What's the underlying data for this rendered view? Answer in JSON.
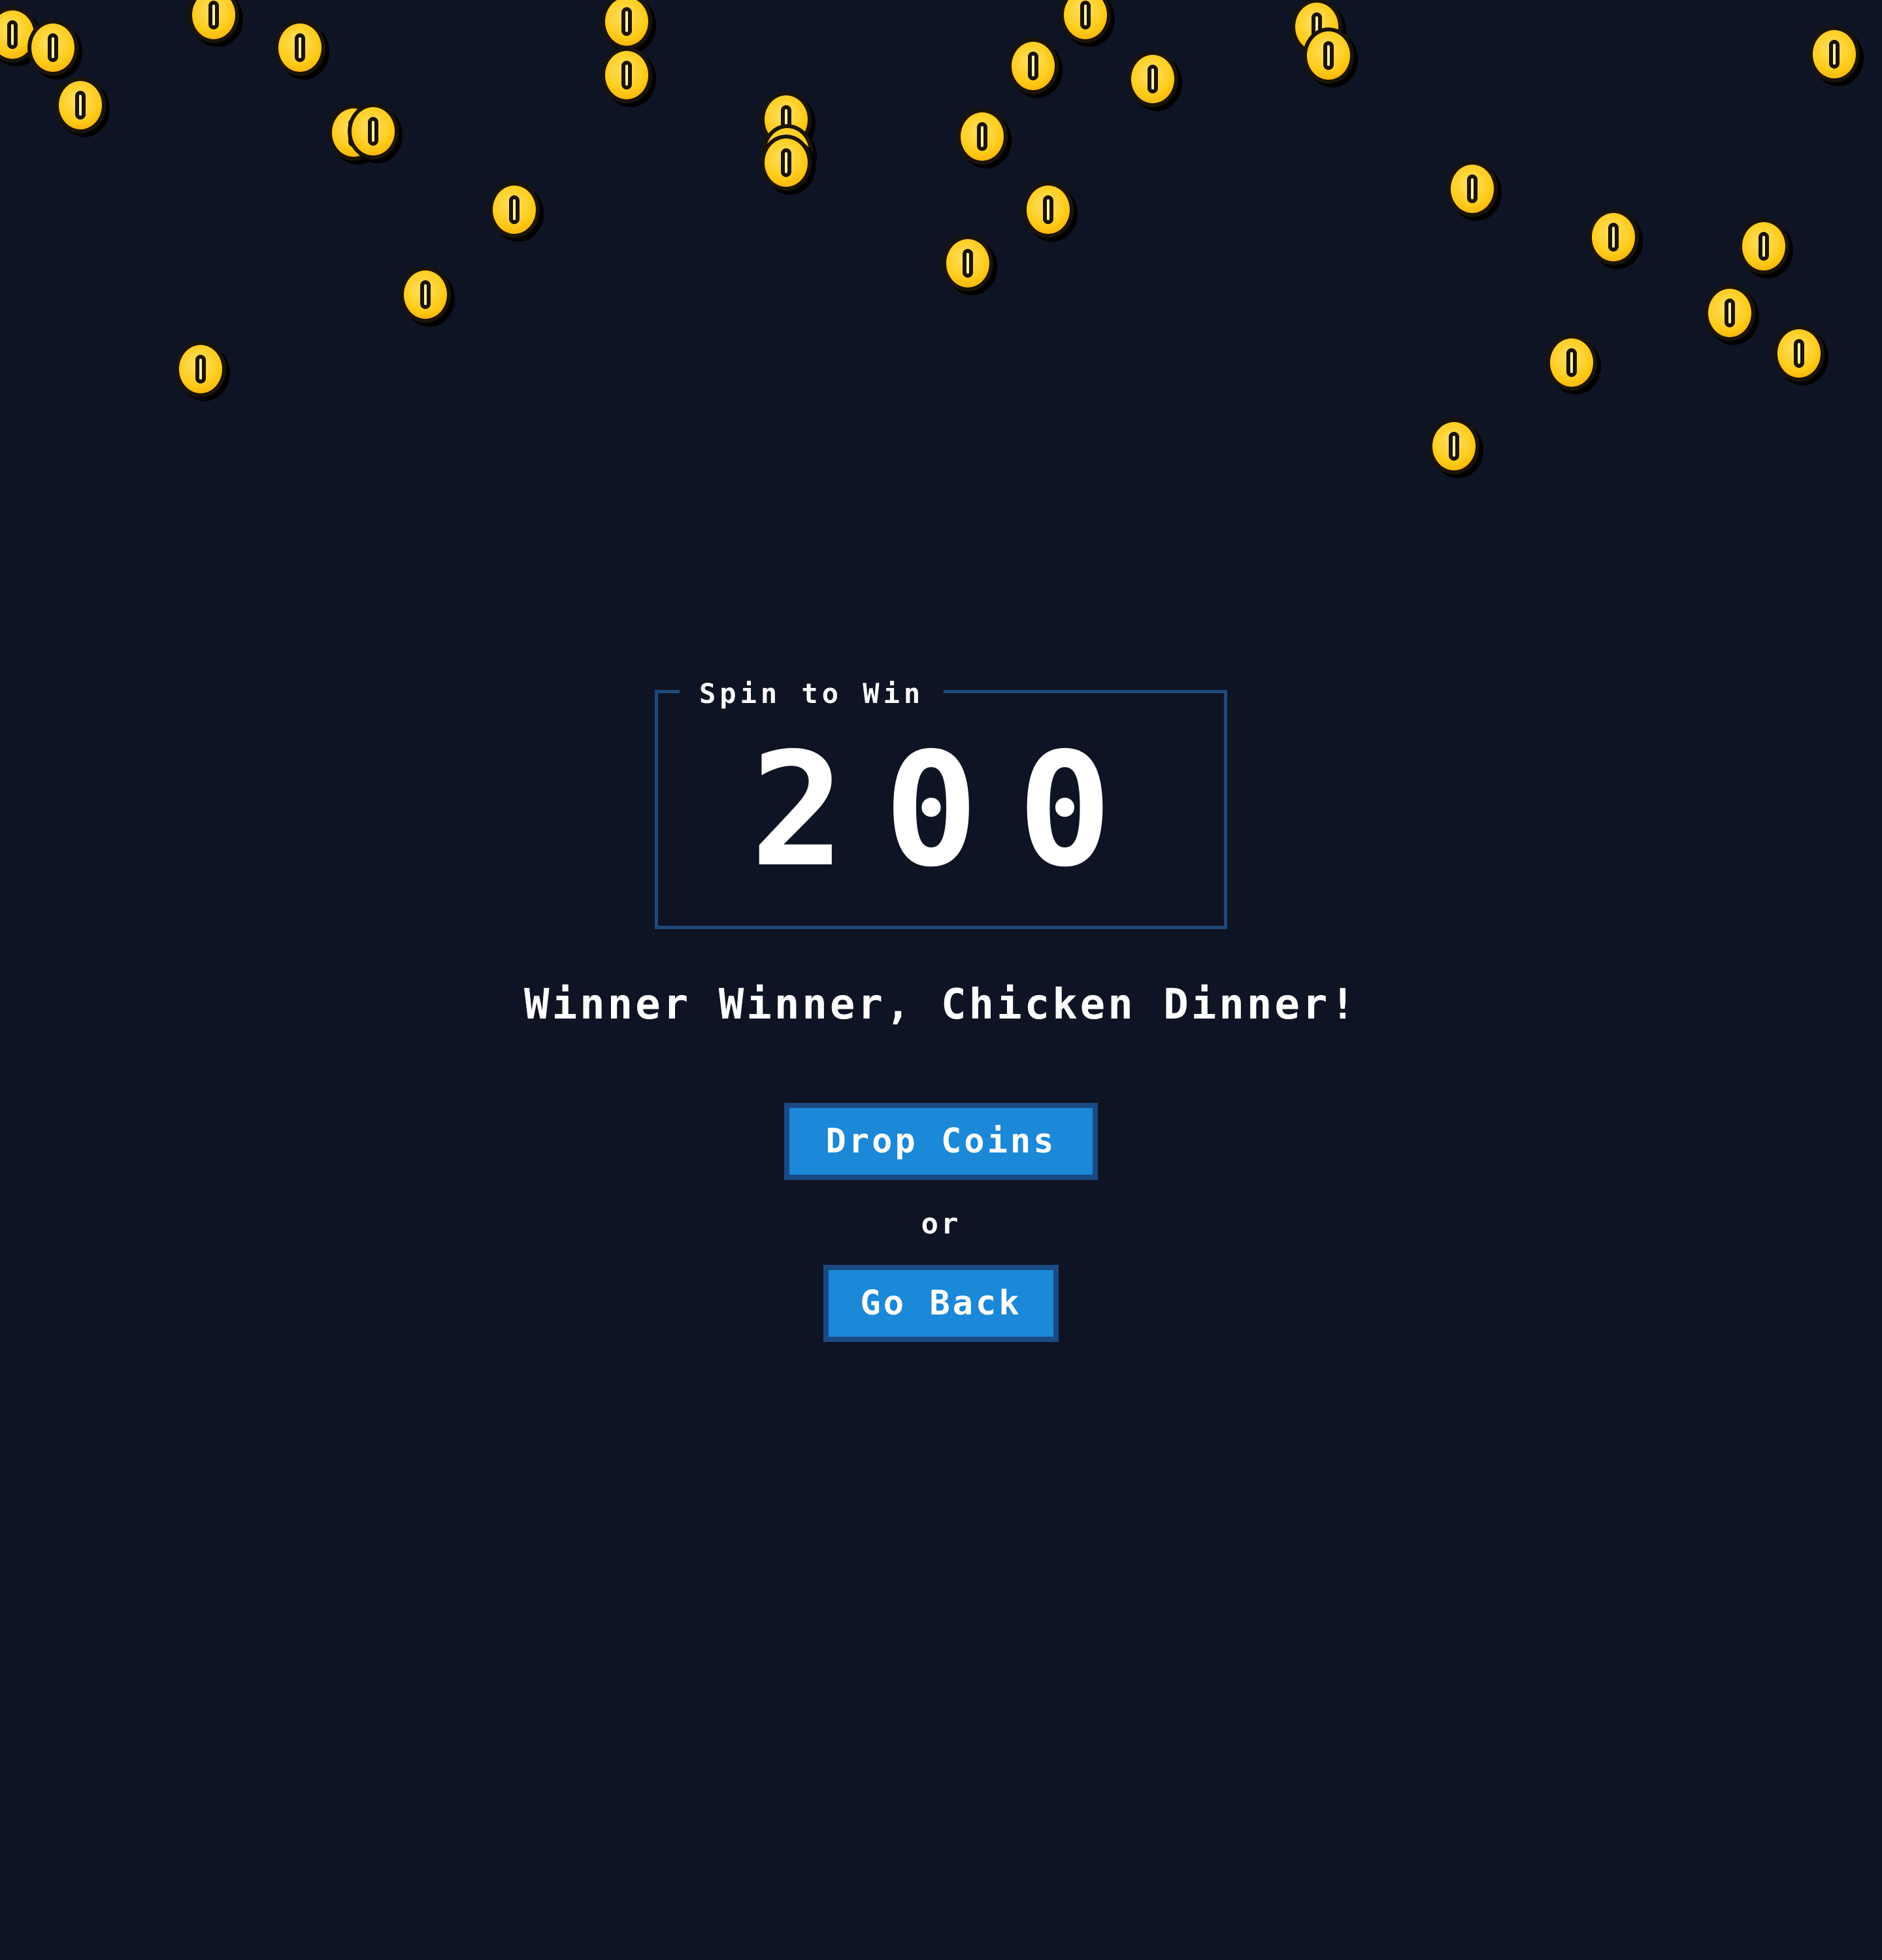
{
  "spin_box": {
    "label": "Spin to Win",
    "value": "200"
  },
  "headline": "Winner Winner, Chicken Dinner!",
  "actions": {
    "drop_coins_label": "Drop Coins",
    "separator": "or",
    "go_back_label": "Go Back"
  },
  "colors": {
    "background": "#0f1424",
    "button": "#1b88d8",
    "button_border": "#1a4a84",
    "coin": "#ffcc1a",
    "box_border": "#1e4a7a"
  },
  "coins": {
    "icon": "coin-icon"
  }
}
